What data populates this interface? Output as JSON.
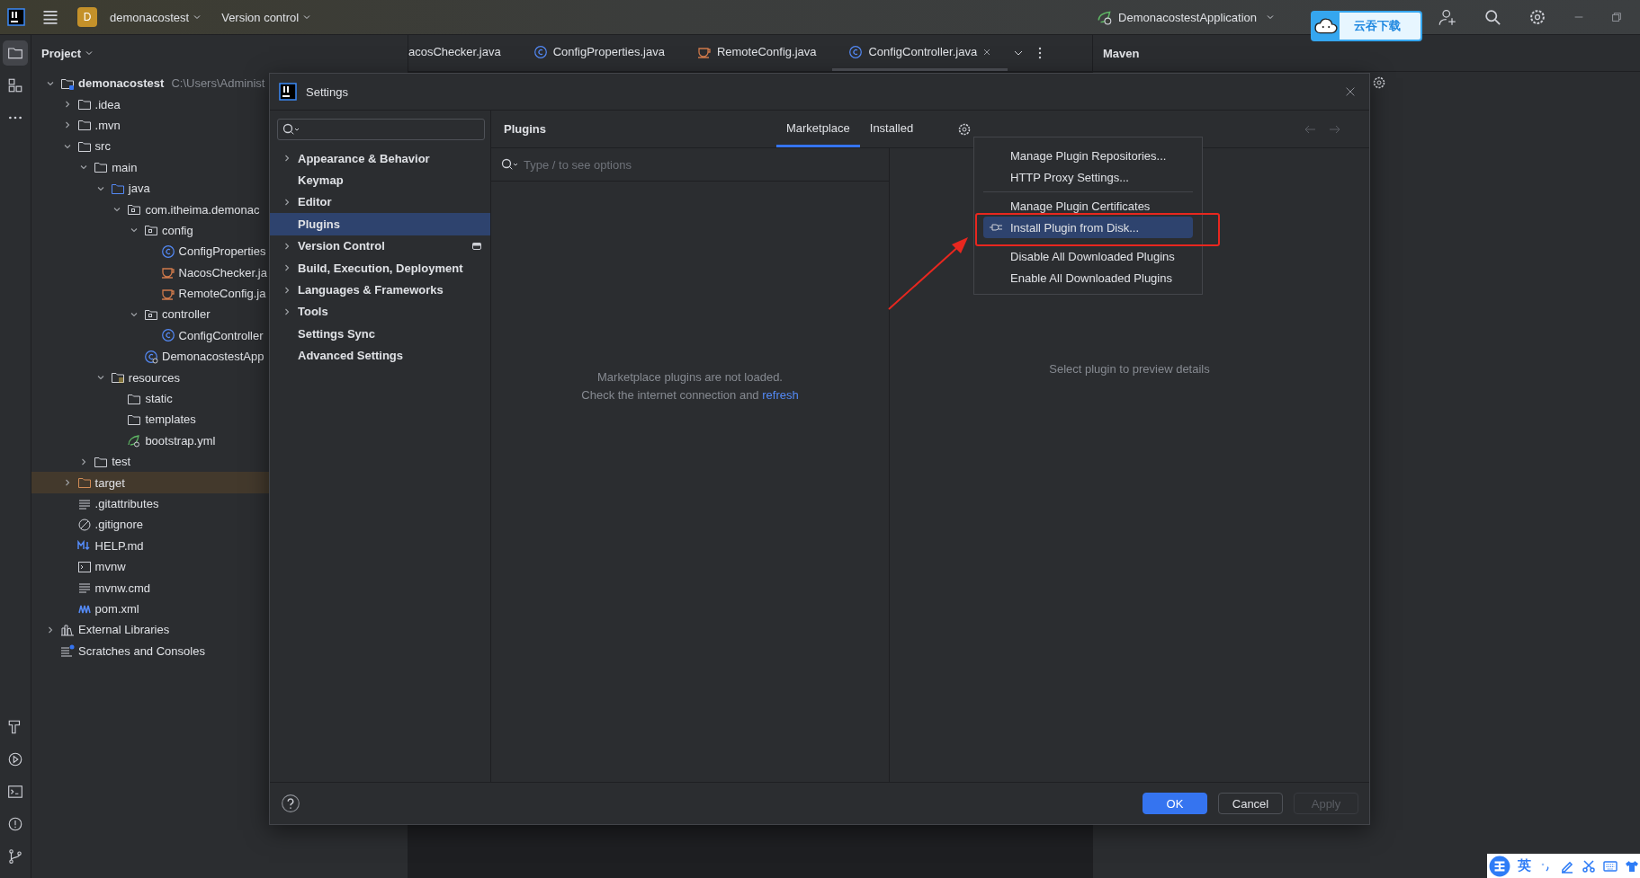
{
  "title_bar": {
    "project_badge": "D",
    "project_name": "demonacostest",
    "vcs": "Version control",
    "run_config": "DemonacostestApplication"
  },
  "download_widget": {
    "label": "云吞下载"
  },
  "tool_windows_top": [
    {
      "kind": "project",
      "selected": true
    },
    {
      "kind": "structure",
      "selected": false
    },
    {
      "kind": "more",
      "selected": false
    }
  ],
  "tool_windows_bottom": [
    {
      "kind": "build",
      "selected": false
    },
    {
      "kind": "run",
      "selected": false
    },
    {
      "kind": "terminal",
      "selected": false
    },
    {
      "kind": "problems",
      "selected": false
    },
    {
      "kind": "git",
      "selected": false
    }
  ],
  "project_panel": {
    "title": "Project",
    "tree": [
      {
        "name": "demonacostest",
        "path": "C:\\Users\\Administ",
        "kind": "project",
        "expanded": true,
        "selected": false,
        "children": [
          {
            "name": ".idea",
            "kind": "folder",
            "expanded": false,
            "selected": false
          },
          {
            "name": ".mvn",
            "kind": "folder",
            "expanded": false,
            "selected": false
          },
          {
            "name": "src",
            "kind": "folder",
            "expanded": true,
            "selected": false,
            "children": [
              {
                "name": "main",
                "kind": "folder",
                "expanded": true,
                "selected": false,
                "children": [
                  {
                    "name": "java",
                    "kind": "source",
                    "expanded": true,
                    "selected": false,
                    "children": [
                      {
                        "name": "com.itheima.demonac",
                        "kind": "package",
                        "expanded": true,
                        "selected": false,
                        "children": [
                          {
                            "name": "config",
                            "kind": "package",
                            "expanded": true,
                            "selected": false,
                            "children": [
                              {
                                "name": "ConfigProperties",
                                "kind": "class",
                                "selected": false
                              },
                              {
                                "name": "NacosChecker.ja",
                                "kind": "java",
                                "selected": false
                              },
                              {
                                "name": "RemoteConfig.ja",
                                "kind": "java",
                                "selected": false
                              }
                            ]
                          },
                          {
                            "name": "controller",
                            "kind": "package",
                            "expanded": true,
                            "selected": false,
                            "children": [
                              {
                                "name": "ConfigController",
                                "kind": "class",
                                "selected": false
                              }
                            ]
                          },
                          {
                            "name": "DemonacostestApp",
                            "kind": "app",
                            "selected": false
                          }
                        ]
                      }
                    ]
                  },
                  {
                    "name": "resources",
                    "kind": "resources",
                    "expanded": true,
                    "selected": false,
                    "children": [
                      {
                        "name": "static",
                        "kind": "folder",
                        "selected": false
                      },
                      {
                        "name": "templates",
                        "kind": "folder",
                        "selected": false
                      },
                      {
                        "name": "bootstrap.yml",
                        "kind": "yaml",
                        "selected": false
                      }
                    ]
                  }
                ]
              },
              {
                "name": "test",
                "kind": "folder",
                "expanded": false,
                "selected": false
              }
            ]
          },
          {
            "name": "target",
            "kind": "excluded",
            "expanded": false,
            "selected": true
          },
          {
            "name": ".gitattributes",
            "kind": "text",
            "selected": false
          },
          {
            "name": ".gitignore",
            "kind": "ignore",
            "selected": false
          },
          {
            "name": "HELP.md",
            "kind": "markdown",
            "selected": false
          },
          {
            "name": "mvnw",
            "kind": "script",
            "selected": false
          },
          {
            "name": "mvnw.cmd",
            "kind": "text",
            "selected": false
          },
          {
            "name": "pom.xml",
            "kind": "maven",
            "selected": false
          }
        ]
      },
      {
        "name": "External Libraries",
        "kind": "libraries",
        "expanded": false,
        "selected": false
      },
      {
        "name": "Scratches and Consoles",
        "kind": "scratches",
        "selected": false
      }
    ]
  },
  "editor_tabs": [
    {
      "label": "acosChecker.java",
      "kind": "java",
      "selected": false
    },
    {
      "label": "ConfigProperties.java",
      "kind": "class",
      "selected": false
    },
    {
      "label": "RemoteConfig.java",
      "kind": "java",
      "selected": false
    },
    {
      "label": "ConfigController.java",
      "kind": "class",
      "selected": true
    }
  ],
  "maven_panel": {
    "title": "Maven"
  },
  "settings": {
    "title": "Settings",
    "nav": [
      {
        "label": "Appearance & Behavior",
        "expandable": true,
        "selected": false,
        "modified": false
      },
      {
        "label": "Keymap",
        "expandable": false,
        "selected": false,
        "modified": false
      },
      {
        "label": "Editor",
        "expandable": true,
        "selected": false,
        "modified": false
      },
      {
        "label": "Plugins",
        "expandable": false,
        "selected": true,
        "modified": false
      },
      {
        "label": "Version Control",
        "expandable": true,
        "selected": false,
        "modified": true
      },
      {
        "label": "Build, Execution, Deployment",
        "expandable": true,
        "selected": false,
        "modified": false
      },
      {
        "label": "Languages & Frameworks",
        "expandable": true,
        "selected": false,
        "modified": false
      },
      {
        "label": "Tools",
        "expandable": true,
        "selected": false,
        "modified": false
      },
      {
        "label": "Settings Sync",
        "expandable": false,
        "selected": false,
        "modified": false
      },
      {
        "label": "Advanced Settings",
        "expandable": false,
        "selected": false,
        "modified": false
      }
    ],
    "plugins": {
      "title": "Plugins",
      "tabs": [
        {
          "label": "Marketplace",
          "selected": true
        },
        {
          "label": "Installed",
          "selected": false
        }
      ],
      "search_placeholder": "Type / to see options",
      "empty_message": "Marketplace plugins are not loaded.",
      "hint": "Check the internet connection and",
      "hint_link": "refresh",
      "detail_message": "Select plugin to preview details",
      "menu": {
        "groups": [
          [
            {
              "label": "Manage Plugin Repositories...",
              "selected": false,
              "icon": false
            },
            {
              "label": "HTTP Proxy Settings...",
              "selected": false,
              "icon": false
            }
          ],
          [
            {
              "label": "Manage Plugin Certificates",
              "selected": false,
              "icon": false
            },
            {
              "label": "Install Plugin from Disk...",
              "selected": true,
              "icon": true
            },
            {
              "label": "Disable All Downloaded Plugins",
              "selected": false,
              "icon": false
            },
            {
              "label": "Enable All Downloaded Plugins",
              "selected": false,
              "icon": false
            }
          ]
        ]
      }
    },
    "buttons": [
      {
        "label": "OK",
        "kind": "primary",
        "disabled": false
      },
      {
        "label": "Cancel",
        "kind": "secondary",
        "disabled": false
      },
      {
        "label": "Apply",
        "kind": "secondary",
        "disabled": true
      }
    ]
  },
  "ime_bar": {
    "language": "英"
  }
}
